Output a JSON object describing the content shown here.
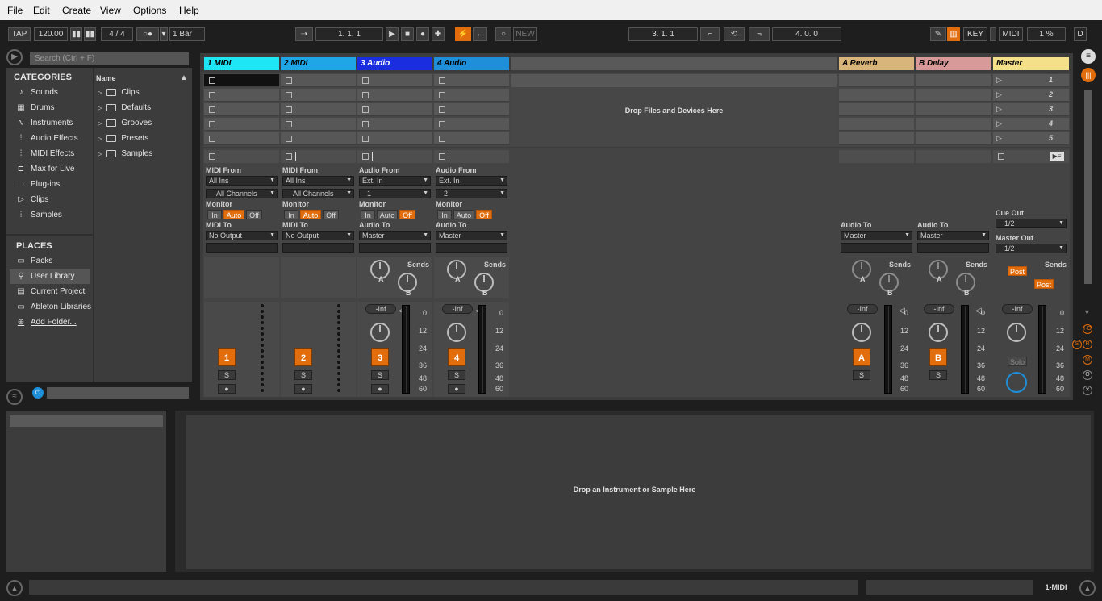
{
  "menu": [
    "File",
    "Edit",
    "Create",
    "View",
    "Options",
    "Help"
  ],
  "transport": {
    "tap": "TAP",
    "tempo": "120.00",
    "signature": "4 / 4",
    "quantize": "1 Bar",
    "position": "1.   1.   1",
    "new": "NEW",
    "loop_start": "3.   1.   1",
    "loop_length": "4.   0.   0",
    "key": "KEY",
    "midi": "MIDI",
    "cpu": "1 %",
    "d": "D"
  },
  "browser": {
    "search_placeholder": "Search (Ctrl + F)",
    "categories_title": "CATEGORIES",
    "name_col": "Name",
    "categories": [
      "Sounds",
      "Drums",
      "Instruments",
      "Audio Effects",
      "MIDI Effects",
      "Max for Live",
      "Plug-ins",
      "Clips",
      "Samples"
    ],
    "places_title": "PLACES",
    "places": [
      "Packs",
      "User Library",
      "Current Project",
      "Ableton Libraries",
      "Add Folder..."
    ],
    "folders": [
      "Clips",
      "Defaults",
      "Grooves",
      "Presets",
      "Samples"
    ]
  },
  "tracks": [
    {
      "name": "1 MIDI",
      "color": "#1ee6f5",
      "from_label": "MIDI From",
      "from": "All Ins",
      "channel": "All Channels",
      "to_label": "MIDI To",
      "to": "No Output",
      "num": "1"
    },
    {
      "name": "2 MIDI",
      "color": "#1ea6e6",
      "from_label": "MIDI From",
      "from": "All Ins",
      "channel": "All Channels",
      "to_label": "MIDI To",
      "to": "No Output",
      "num": "2"
    },
    {
      "name": "3 Audio",
      "color": "#1a2ee0",
      "from_label": "Audio From",
      "from": "Ext. In",
      "channel": "1",
      "to_label": "Audio To",
      "to": "Master",
      "num": "3"
    },
    {
      "name": "4 Audio",
      "color": "#1e8fd8",
      "from_label": "Audio From",
      "from": "Ext. In",
      "channel": "2",
      "to_label": "Audio To",
      "to": "Master",
      "num": "4"
    }
  ],
  "returns": [
    {
      "name": "A Reverb",
      "color": "#d8b57a",
      "to_label": "Audio To",
      "to": "Master",
      "num": "A"
    },
    {
      "name": "B Delay",
      "color": "#d89a98",
      "to_label": "Audio To",
      "to": "Master",
      "num": "B"
    }
  ],
  "master": {
    "name": "Master",
    "color": "#f5e08a",
    "scenes": [
      "1",
      "2",
      "3",
      "4",
      "5"
    ],
    "cue_label": "Cue Out",
    "cue": "1/2",
    "out_label": "Master Out",
    "out": "1/2",
    "post": "Post",
    "solo": "Solo"
  },
  "mixer": {
    "monitor": "Monitor",
    "in": "In",
    "auto": "Auto",
    "off": "Off",
    "sends": "Sends",
    "a": "A",
    "b": "B",
    "inf": "-Inf",
    "s": "S",
    "scale": [
      "0",
      "12",
      "24",
      "36",
      "48",
      "60"
    ]
  },
  "drop_files": "Drop Files and Devices Here",
  "drop_instrument": "Drop an Instrument or Sample Here",
  "status_track": "1-MIDI",
  "accent": "#e26d0c"
}
